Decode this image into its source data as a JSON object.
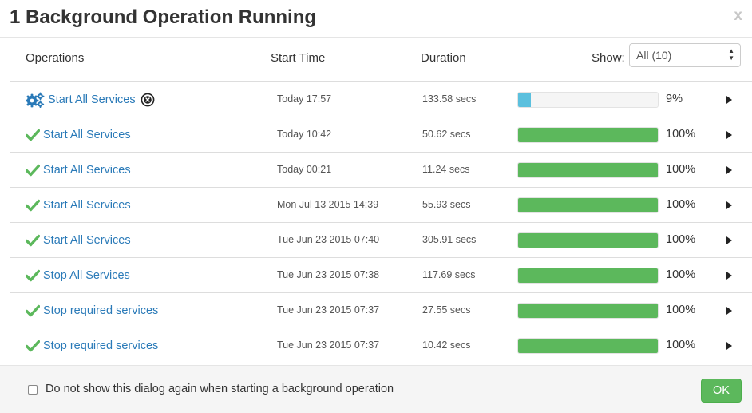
{
  "dialog": {
    "title": "1 Background Operation Running",
    "close_label": "x"
  },
  "columns": {
    "operations": "Operations",
    "start_time": "Start Time",
    "duration": "Duration",
    "show_label": "Show:",
    "show_value": "All (10)"
  },
  "colors": {
    "link": "#2a7ab8",
    "progress_running": "#5bc0de",
    "progress_done": "#5cb85c",
    "ok_button": "#5cb85c"
  },
  "operations": [
    {
      "name": "Start All Services",
      "status": "running",
      "start": "Today 17:57",
      "duration": "133.58 secs",
      "progress": 9,
      "progress_text": "9%"
    },
    {
      "name": "Start All Services",
      "status": "done",
      "start": "Today 10:42",
      "duration": "50.62 secs",
      "progress": 100,
      "progress_text": "100%"
    },
    {
      "name": "Start All Services",
      "status": "done",
      "start": "Today 00:21",
      "duration": "11.24 secs",
      "progress": 100,
      "progress_text": "100%"
    },
    {
      "name": "Start All Services",
      "status": "done",
      "start": "Mon Jul 13 2015 14:39",
      "duration": "55.93 secs",
      "progress": 100,
      "progress_text": "100%"
    },
    {
      "name": "Start All Services",
      "status": "done",
      "start": "Tue Jun 23 2015 07:40",
      "duration": "305.91 secs",
      "progress": 100,
      "progress_text": "100%"
    },
    {
      "name": "Stop All Services",
      "status": "done",
      "start": "Tue Jun 23 2015 07:38",
      "duration": "117.69 secs",
      "progress": 100,
      "progress_text": "100%"
    },
    {
      "name": "Stop required services",
      "status": "done",
      "start": "Tue Jun 23 2015 07:37",
      "duration": "27.55 secs",
      "progress": 100,
      "progress_text": "100%"
    },
    {
      "name": "Stop required services",
      "status": "done",
      "start": "Tue Jun 23 2015 07:37",
      "duration": "10.42 secs",
      "progress": 100,
      "progress_text": "100%"
    }
  ],
  "footer": {
    "checkbox_label": "Do not show this dialog again when starting a background operation",
    "checkbox_checked": false,
    "ok_label": "OK"
  }
}
